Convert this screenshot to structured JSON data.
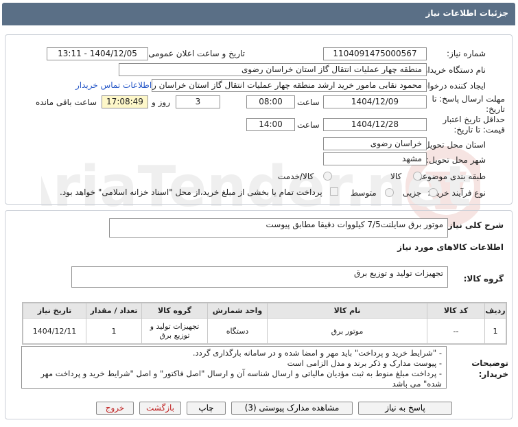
{
  "page_title": "جزئیات اطلاعات نیاز",
  "fields": {
    "need_number_label": "شماره نیاز:",
    "need_number": "1104091475000567",
    "announce_datetime_label": "تاریخ و ساعت اعلان عمومی:",
    "announce_datetime": "1404/12/05 - 13:11",
    "buyer_org_label": "نام دستگاه خریدار:",
    "buyer_org": "منطقه چهار عملیات انتقال گاز   استان خراسان رضوی",
    "requester_label": "ایجاد کننده درخواست:",
    "requester": "محمود نقابی مامور خرید ارشد منطقه چهار عملیات انتقال گاز   استان خراسان رضوی",
    "contact_link": "اطلاعات تماس خریدار",
    "reply_deadline_label": "مهلت ارسال پاسخ: تا تاریخ:",
    "reply_date": "1404/12/09",
    "time_label": "ساعت",
    "reply_time": "08:00",
    "days_value": "3",
    "days_label": "روز و",
    "remaining_time": "17:08:49",
    "remaining_label": "ساعت باقی مانده",
    "validity_label": "حداقل تاریخ اعتبار قیمت: تا تاریخ:",
    "validity_date": "1404/12/28",
    "validity_time": "14:00",
    "province_label": "استان محل تحویل:",
    "province": "خراسان رضوی",
    "city_label": "شهر محل تحویل:",
    "city": "مشهد",
    "category_label": "طبقه بندی موضوعی:",
    "category_options": [
      "کالا",
      "کالا/خدمت"
    ],
    "purchase_type_label": "نوع فرآیند خرید :",
    "purchase_type_options": [
      "جزیی",
      "متوسط"
    ],
    "payment_note": "پرداخت تمام یا بخشی از مبلغ خرید،از محل \"اسناد خزانه اسلامی\" خواهد بود."
  },
  "description": {
    "label": "شرح کلی نیاز:",
    "value": "موتور برق سایلنت7/5 کیلووات دقیقا مطابق پیوست"
  },
  "goods_section_title": "اطلاعات کالاهای مورد نیاز",
  "goods_group": {
    "label": "گروه کالا:",
    "value": "تجهیزات تولید و توزیع برق"
  },
  "table": {
    "headers": [
      "ردیف",
      "کد کالا",
      "نام کالا",
      "واحد شمارش",
      "گروه کالا",
      "تعداد / مقدار",
      "تاریخ نیاز"
    ],
    "rows": [
      [
        "1",
        "--",
        "موتور برق",
        "دستگاه",
        "تجهیزات تولید و توزیع برق",
        "1",
        "1404/12/11"
      ]
    ]
  },
  "buyer_notes": {
    "label": "توضیحات خریدار:",
    "lines": [
      "-  \"شرایط خرید و پرداخت\" باید مهر و امضا شده و در سامانه بارگذاری گردد.",
      "- پیوست مدارک و ذکر برند و مدل الزامی است",
      "- پرداخت مبلغ منوط به ثبت مؤدیان مالیاتی و ارسال شناسه آن و ارسال \"اصل فاکتور\" و اصل \"شرایط خرید و پرداخت مهر شده\" می باشد"
    ]
  },
  "buttons": {
    "reply": "پاسخ به نیاز",
    "view_docs": "مشاهده مدارک پیوستی (3)",
    "print": "چاپ",
    "back": "بازگشت",
    "exit": "خروج"
  },
  "colors": {
    "titlebar": "#5a6f86",
    "link": "#2a5ac8",
    "remaining_bg": "#fdf7c9",
    "danger_text": "#c02424"
  }
}
